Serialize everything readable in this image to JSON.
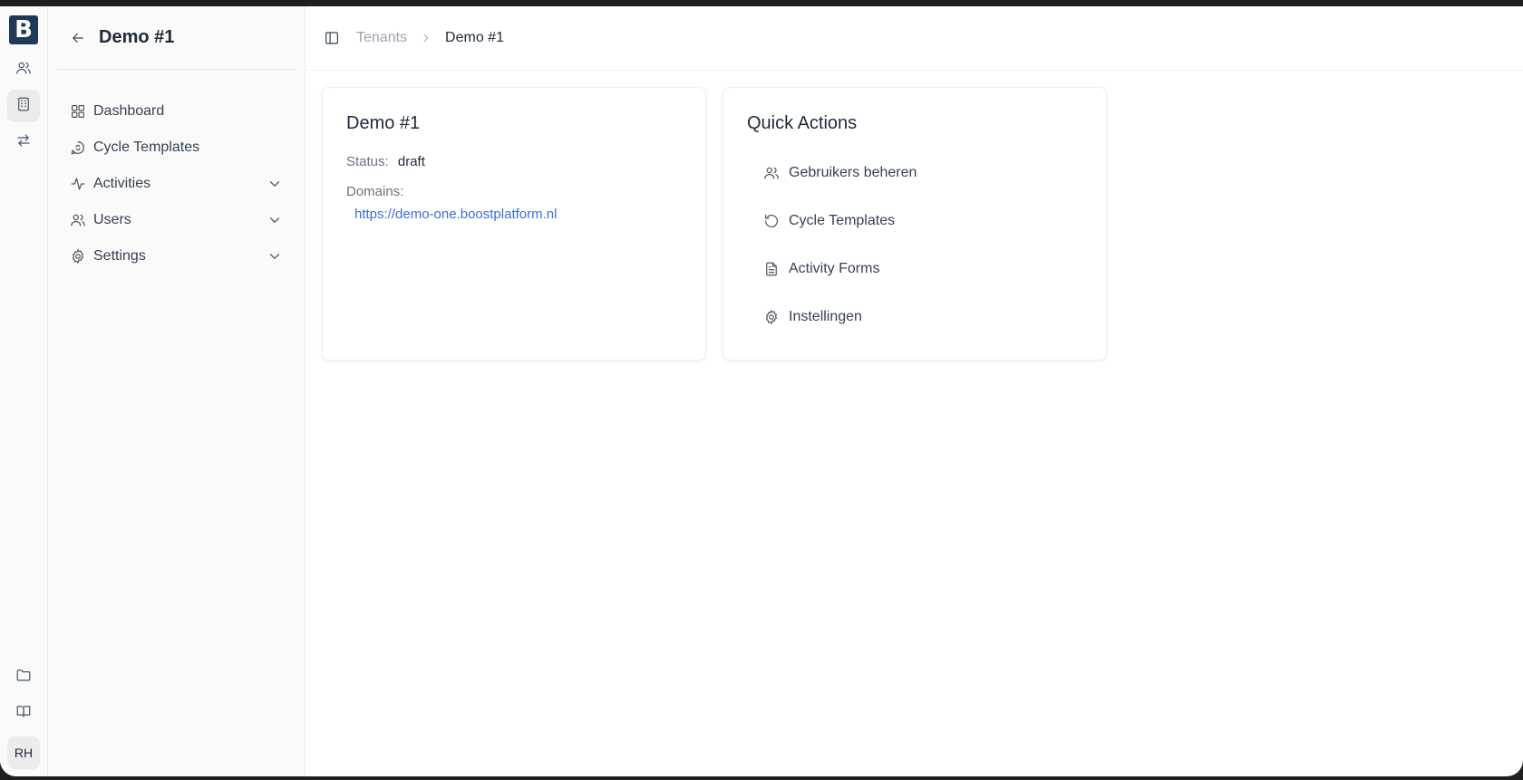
{
  "rail": {
    "logo": "B",
    "avatar": "RH",
    "icons": [
      "users-icon",
      "building-icon",
      "arrows-swap-icon",
      "folder-icon",
      "book-icon"
    ]
  },
  "sidenav": {
    "title": "Demo #1",
    "items": [
      {
        "label": "Dashboard",
        "icon": "grid-icon",
        "expandable": false
      },
      {
        "label": "Cycle Templates",
        "icon": "message-cycle-icon",
        "expandable": false
      },
      {
        "label": "Activities",
        "icon": "activity-icon",
        "expandable": true
      },
      {
        "label": "Users",
        "icon": "users-icon",
        "expandable": true
      },
      {
        "label": "Settings",
        "icon": "gear-icon",
        "expandable": true
      }
    ]
  },
  "breadcrumb": {
    "parent": "Tenants",
    "current": "Demo #1"
  },
  "tenant_card": {
    "title": "Demo #1",
    "status_label": "Status:",
    "status_value": "draft",
    "domains_label": "Domains:",
    "domain": "https://demo-one.boostplatform.nl"
  },
  "quick_actions": {
    "title": "Quick Actions",
    "items": [
      {
        "label": "Gebruikers beheren",
        "icon": "users-icon"
      },
      {
        "label": "Cycle Templates",
        "icon": "refresh-icon"
      },
      {
        "label": "Activity Forms",
        "icon": "document-icon"
      },
      {
        "label": "Instellingen",
        "icon": "gear-icon"
      }
    ]
  },
  "colors": {
    "brand": "#1e3a56",
    "link": "#3b6fd8"
  }
}
